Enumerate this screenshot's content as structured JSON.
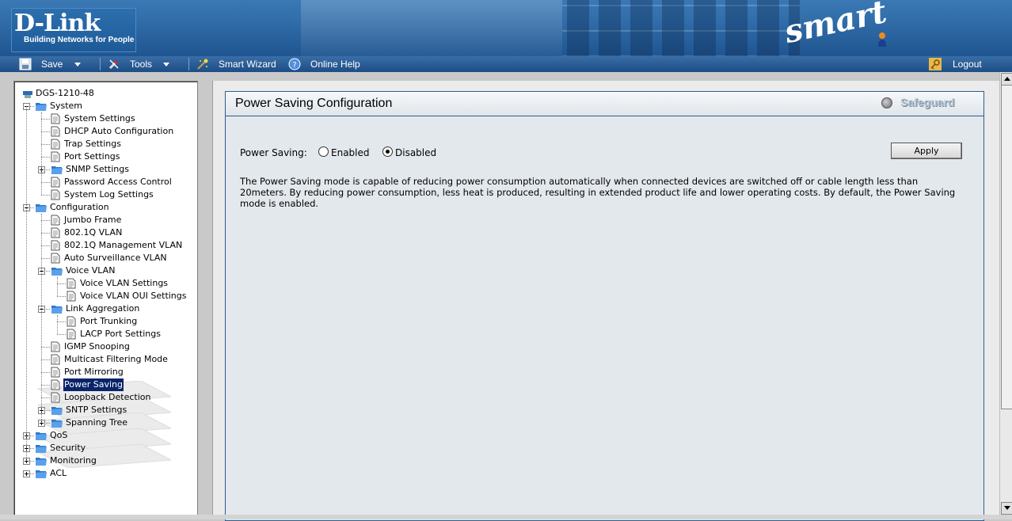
{
  "banner": {
    "logo_main": "D-Link",
    "logo_tagline": "Building Networks for People",
    "product_logo": "smart"
  },
  "menubar": {
    "save": "Save",
    "tools": "Tools",
    "smart_wizard": "Smart Wizard",
    "online_help": "Online Help",
    "logout": "Logout"
  },
  "tree": {
    "root": "DGS-1210-48",
    "system": "System",
    "system_settings": "System Settings",
    "dhcp_auto": "DHCP Auto Configuration",
    "trap_settings": "Trap Settings",
    "port_settings": "Port Settings",
    "snmp_settings": "SNMP Settings",
    "password_access": "Password Access Control",
    "system_log": "System Log Settings",
    "configuration": "Configuration",
    "jumbo_frame": "Jumbo Frame",
    "vlan_8021q": "802.1Q VLAN",
    "mgmt_vlan": "802.1Q Management VLAN",
    "auto_surveillance": "Auto Surveillance VLAN",
    "voice_vlan": "Voice VLAN",
    "voice_vlan_settings": "Voice VLAN Settings",
    "voice_vlan_oui": "Voice VLAN OUI Settings",
    "link_aggregation": "Link Aggregation",
    "port_trunking": "Port Trunking",
    "lacp_port": "LACP Port Settings",
    "igmp_snooping": "IGMP Snooping",
    "multicast_filtering": "Multicast Filtering Mode",
    "port_mirroring": "Port Mirroring",
    "power_saving": "Power Saving",
    "loopback_detection": "Loopback Detection",
    "sntp_settings": "SNTP Settings",
    "spanning_tree": "Spanning Tree",
    "qos": "QoS",
    "security": "Security",
    "monitoring": "Monitoring",
    "acl": "ACL"
  },
  "content": {
    "title": "Power Saving Configuration",
    "safeguard": "Safeguard",
    "power_saving_label": "Power Saving:",
    "enabled_label": "Enabled",
    "disabled_label": "Disabled",
    "selected": "Disabled",
    "apply_label": "Apply",
    "description": "The Power Saving mode is capable of reducing power consumption automatically when connected devices are switched off or cable length less than 20meters. By reducing power consumption, less heat is produced, resulting in extended product life and lower operating costs. By default, the Power Saving mode is enabled."
  },
  "colors": {
    "banner_blue": "#2f6aa6",
    "menubar_blue": "#1d4d86",
    "selection_navy": "#0a246a",
    "panel_border": "#2c5d8f"
  }
}
